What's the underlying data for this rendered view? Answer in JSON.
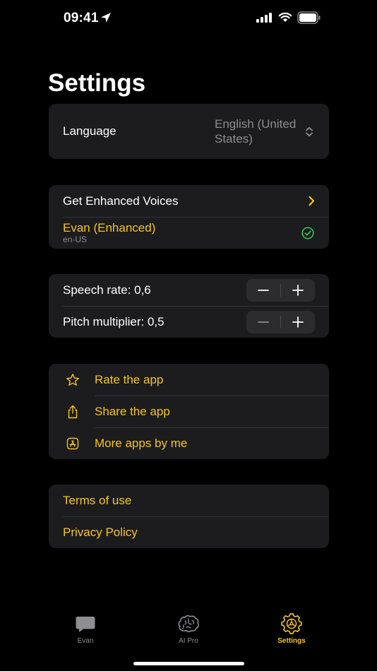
{
  "status_bar": {
    "time": "09:41"
  },
  "page": {
    "title": "Settings"
  },
  "language": {
    "label": "Language",
    "value": "English (United States)"
  },
  "voices": {
    "get_enhanced": "Get Enhanced Voices",
    "selected_name": "Evan (Enhanced)",
    "selected_locale": "en-US"
  },
  "speech": {
    "rate_label": "Speech rate: 0,6",
    "pitch_label": "Pitch multiplier: 0,5",
    "minus": "−",
    "plus": "+"
  },
  "actions": {
    "rate_app": "Rate the app",
    "share_app": "Share the app",
    "more_apps": "More apps by me"
  },
  "legal": {
    "terms": "Terms of use",
    "privacy": "Privacy Policy"
  },
  "tabs": [
    {
      "label": "Evan",
      "icon": "chat-bubble-icon",
      "active": false
    },
    {
      "label": "AI Pro",
      "icon": "brain-icon",
      "active": false
    },
    {
      "label": "Settings",
      "icon": "gear-icon",
      "active": true
    }
  ],
  "colors": {
    "accent": "#f5c518",
    "background": "#000000",
    "card": "#1c1c1e",
    "secondary_text": "#8d8d92",
    "check_green": "#30d158"
  }
}
